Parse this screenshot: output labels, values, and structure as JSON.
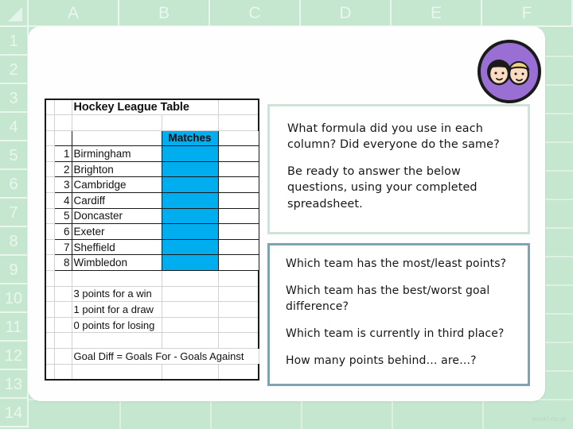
{
  "background": {
    "app": "spreadsheet",
    "column_headers": [
      "A",
      "B",
      "C",
      "D",
      "E",
      "F"
    ],
    "row_headers": [
      "1",
      "2",
      "3",
      "4",
      "5",
      "6",
      "7",
      "8",
      "9",
      "10",
      "11",
      "12",
      "13",
      "14"
    ],
    "grid_color": "#c5e6cf",
    "header_text_color": "#e9f7ef"
  },
  "avatar": {
    "name": "two-children-avatar",
    "circle_color": "#9a6fd4",
    "face_color": "#fbdcc2",
    "hair_left_color": "#1a1a1a",
    "hair_right_color": "#f0d27a"
  },
  "table": {
    "title": "Hockey League Table",
    "header_label": "Matches",
    "header_fill": "#00ADEF",
    "rows": [
      {
        "rank": "1",
        "team": "Birmingham"
      },
      {
        "rank": "2",
        "team": "Brighton"
      },
      {
        "rank": "3",
        "team": "Cambridge"
      },
      {
        "rank": "4",
        "team": "Cardiff"
      },
      {
        "rank": "5",
        "team": "Doncaster"
      },
      {
        "rank": "6",
        "team": "Exeter"
      },
      {
        "rank": "7",
        "team": "Sheffield"
      },
      {
        "rank": "8",
        "team": "Wimbledon"
      }
    ],
    "notes": [
      "3 points for a win",
      "1 point for a draw",
      "0 points for losing"
    ],
    "formula_note": "Goal Diff = Goals For - Goals Against"
  },
  "textbox_top": {
    "border_color": "#cfe3d6",
    "paragraphs": [
      "What formula did you use in each column? Did everyone do the same?",
      "Be ready to answer the below questions, using your completed spreadsheet."
    ]
  },
  "textbox_bottom": {
    "border_color": "#7fa3b3",
    "paragraphs": [
      "Which team has the most/least points?",
      "Which team has the best/worst goal difference?",
      "Which team is currently in third place?",
      "How many points behind… are…?"
    ]
  },
  "watermark": {
    "text": "twinkl.co.uk"
  }
}
